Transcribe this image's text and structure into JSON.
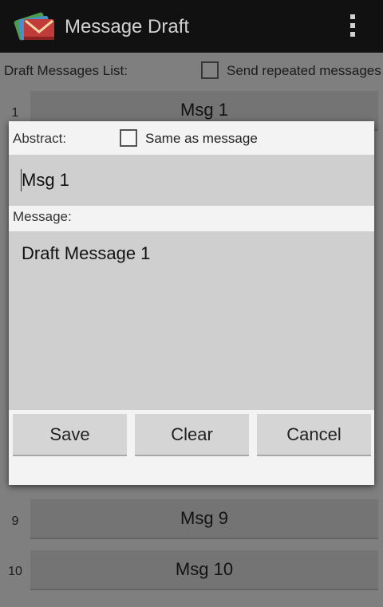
{
  "app": {
    "title": "Message Draft"
  },
  "list": {
    "header": "Draft Messages List:",
    "repeat_label": "Send repeated messages",
    "rows": [
      {
        "num": "1",
        "label": "Msg 1"
      },
      {
        "num": "9",
        "label": "Msg 9"
      },
      {
        "num": "10",
        "label": "Msg 10"
      }
    ]
  },
  "dialog": {
    "abstract_label": "Abstract:",
    "same_label": "Same as message",
    "abstract_value": "Msg 1",
    "message_label": "Message:",
    "message_value": "Draft Message 1",
    "save_label": "Save",
    "clear_label": "Clear",
    "cancel_label": "Cancel"
  },
  "colors": {
    "actionbar": "#111111",
    "background": "#e8e8e8",
    "field": "#cfcfcf",
    "button": "#d5d5d5"
  },
  "icons": [
    "app-envelope-icon",
    "overflow-menu-icon",
    "checkbox-icon"
  ]
}
